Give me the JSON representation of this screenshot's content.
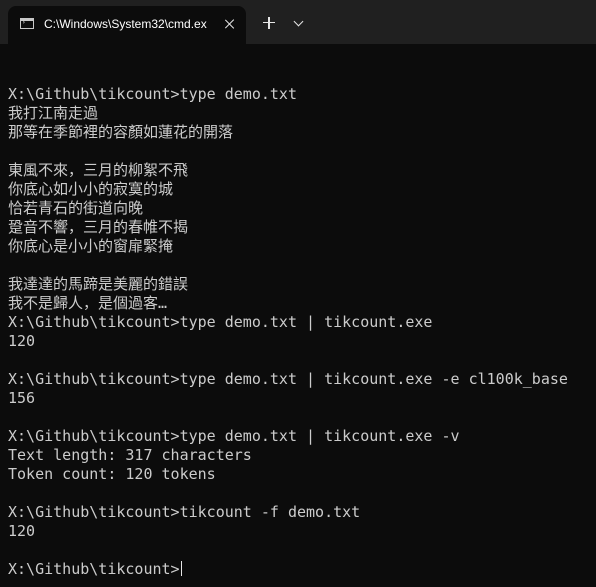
{
  "window": {
    "tab_title": "C:\\Windows\\System32\\cmd.ex",
    "tab_icon": "terminal-icon",
    "close_icon": "close-icon",
    "new_tab_icon": "plus-icon",
    "dropdown_icon": "chevron-down-icon"
  },
  "colors": {
    "background": "#0c0c0c",
    "text": "#cccccc",
    "titlebar": "#202020"
  },
  "console": {
    "lines": [
      "",
      "X:\\Github\\tikcount>type demo.txt",
      "我打江南走過",
      "那等在季節裡的容顏如蓮花的開落",
      "",
      "東風不來，三月的柳絮不飛",
      "你底心如小小的寂寞的城",
      "恰若青石的街道向晚",
      "跫音不響，三月的春帷不揭",
      "你底心是小小的窗扉緊掩",
      "",
      "我達達的馬蹄是美麗的錯誤",
      "我不是歸人，是個過客…",
      "X:\\Github\\tikcount>type demo.txt | tikcount.exe",
      "120",
      "",
      "X:\\Github\\tikcount>type demo.txt | tikcount.exe -e cl100k_base",
      "156",
      "",
      "X:\\Github\\tikcount>type demo.txt | tikcount.exe -v",
      "Text length: 317 characters",
      "Token count: 120 tokens",
      "",
      "X:\\Github\\tikcount>tikcount -f demo.txt",
      "120",
      "",
      "X:\\Github\\tikcount>"
    ]
  }
}
